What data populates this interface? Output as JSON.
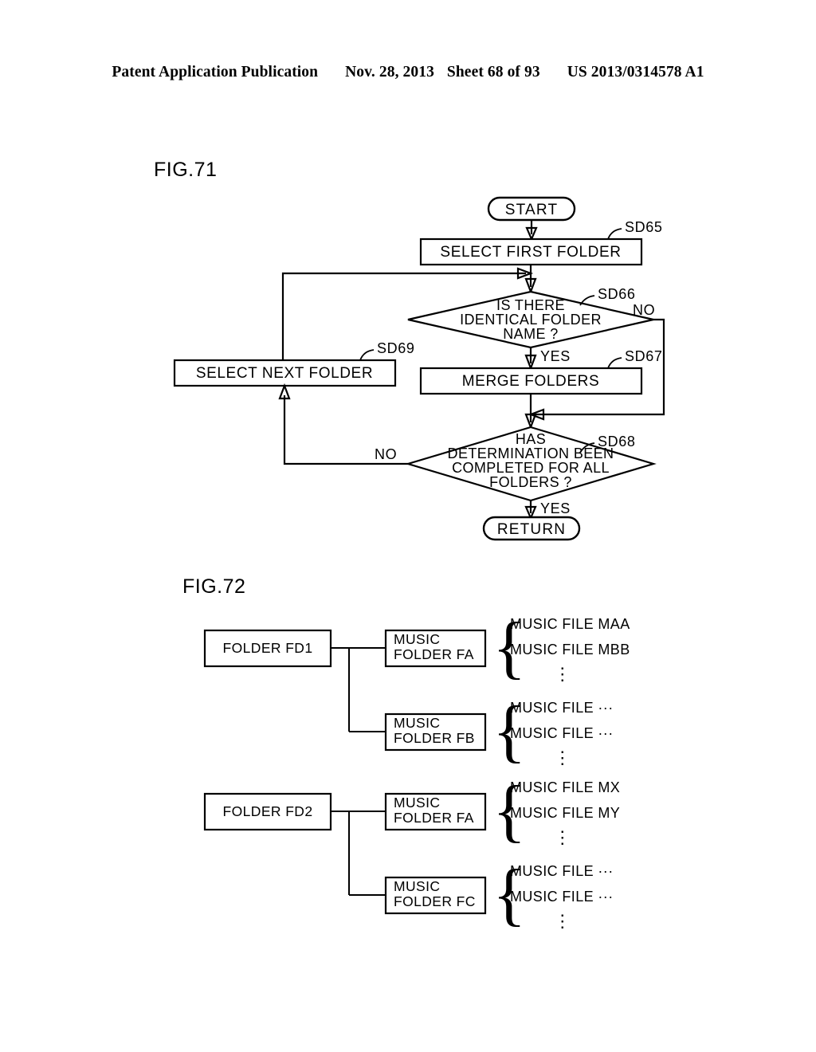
{
  "header": {
    "publication": "Patent Application Publication",
    "date": "Nov. 28, 2013",
    "sheet": "Sheet 68 of 93",
    "patent_number": "US 2013/0314578 A1"
  },
  "figures": [
    {
      "label": "FIG.71",
      "type": "flowchart",
      "nodes": {
        "start": {
          "shape": "terminator",
          "text": "START"
        },
        "sd65": {
          "shape": "process",
          "text": "SELECT FIRST FOLDER",
          "ref": "SD65"
        },
        "sd66": {
          "shape": "decision",
          "ref": "SD66",
          "lines": [
            "IS THERE",
            "IDENTICAL FOLDER",
            "NAME ?"
          ],
          "yes_label": "YES",
          "no_label": "NO"
        },
        "sd69": {
          "shape": "process",
          "text": "SELECT NEXT FOLDER",
          "ref": "SD69"
        },
        "sd67": {
          "shape": "process",
          "text": "MERGE FOLDERS",
          "ref": "SD67"
        },
        "sd68": {
          "shape": "decision",
          "ref": "SD68",
          "lines": [
            "HAS",
            "DETERMINATION BEEN",
            "COMPLETED FOR ALL",
            "FOLDERS ?"
          ],
          "yes_label": "YES",
          "no_label": "NO"
        },
        "return": {
          "shape": "terminator",
          "text": "RETURN"
        }
      }
    },
    {
      "label": "FIG.72",
      "type": "tree",
      "branches": [
        {
          "folder": "FOLDER FD1",
          "children": [
            {
              "music_folder_line1": "MUSIC",
              "music_folder_line2": "FOLDER FA",
              "files": [
                "MUSIC FILE MAA",
                "MUSIC FILE MBB"
              ],
              "ellipsis": "⋮"
            },
            {
              "music_folder_line1": "MUSIC",
              "music_folder_line2": "FOLDER FB",
              "files": [
                "MUSIC FILE ···",
                "MUSIC FILE ···"
              ],
              "ellipsis": "⋮"
            }
          ]
        },
        {
          "folder": "FOLDER FD2",
          "children": [
            {
              "music_folder_line1": "MUSIC",
              "music_folder_line2": "FOLDER FA",
              "files": [
                "MUSIC FILE MX",
                "MUSIC FILE MY"
              ],
              "ellipsis": "⋮"
            },
            {
              "music_folder_line1": "MUSIC",
              "music_folder_line2": "FOLDER FC",
              "files": [
                "MUSIC FILE ···",
                "MUSIC FILE ···"
              ],
              "ellipsis": "⋮"
            }
          ]
        }
      ],
      "brace_glyph": "{"
    }
  ],
  "colors": {
    "ink": "#000000",
    "paper": "#ffffff"
  }
}
